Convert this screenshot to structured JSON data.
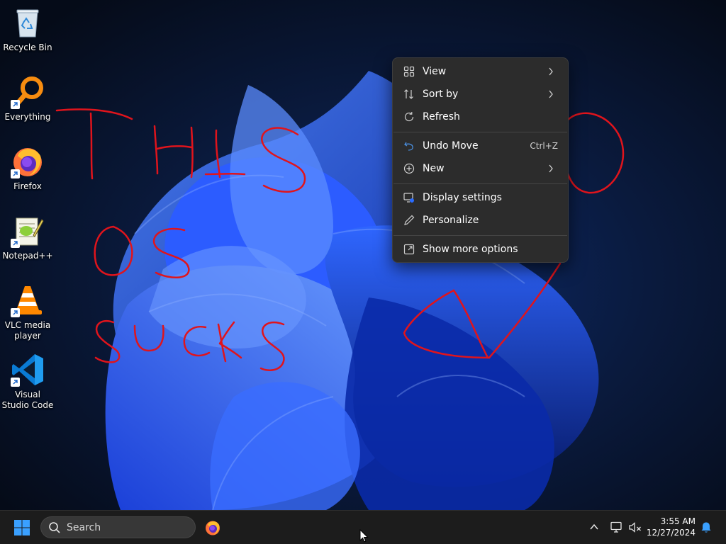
{
  "desktop": {
    "icons": [
      {
        "label": "Recycle Bin",
        "icon": "recycle-bin-icon"
      },
      {
        "label": "Everything",
        "icon": "everything-search-icon"
      },
      {
        "label": "Firefox",
        "icon": "firefox-icon"
      },
      {
        "label": "Notepad++",
        "icon": "notepad-plus-plus-icon"
      },
      {
        "label": "VLC media player",
        "icon": "vlc-icon"
      },
      {
        "label": "Visual Studio Code",
        "icon": "vscode-icon"
      }
    ]
  },
  "context_menu": {
    "items": [
      {
        "label": "View",
        "icon": "grid-icon",
        "submenu": true
      },
      {
        "label": "Sort by",
        "icon": "sort-icon",
        "submenu": true
      },
      {
        "label": "Refresh",
        "icon": "refresh-icon"
      },
      {
        "label": "Undo Move",
        "icon": "undo-icon",
        "shortcut": "Ctrl+Z"
      },
      {
        "label": "New",
        "icon": "plus-circle-icon",
        "submenu": true
      },
      {
        "label": "Display settings",
        "icon": "display-settings-icon"
      },
      {
        "label": "Personalize",
        "icon": "pen-icon"
      },
      {
        "label": "Show more options",
        "icon": "show-more-icon"
      }
    ]
  },
  "annotations": {
    "scrawl_color": "#e0141c"
  },
  "taskbar": {
    "search_label": "Search",
    "pinned": [
      "windows-start-icon",
      "firefox-icon"
    ],
    "tray": [
      "chevron-up-icon",
      "network-icon",
      "volume-muted-icon",
      "bell-icon"
    ],
    "time": "3:55 AM",
    "date": "12/27/2024"
  },
  "colors": {
    "accent": "#2a6cff",
    "menu_bg": "#2c2c2c",
    "taskbar_bg": "#1c1c1c"
  }
}
